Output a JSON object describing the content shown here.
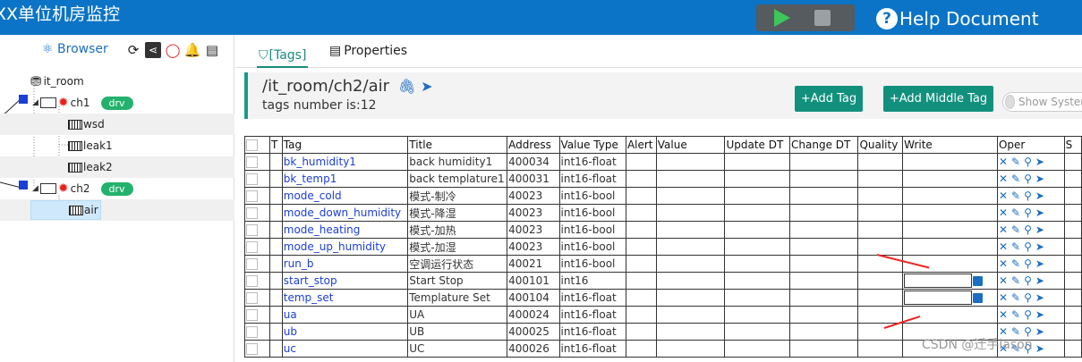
{
  "app": {
    "title": "XX单位机房监控",
    "help": "Help Document"
  },
  "left": {
    "browser_label": "Browser",
    "tree": [
      {
        "label": "it_room"
      },
      {
        "label": "ch1",
        "badge": "drv"
      },
      {
        "label": "wsd"
      },
      {
        "label": "leak1"
      },
      {
        "label": "leak2"
      },
      {
        "label": "ch2",
        "badge": "drv"
      },
      {
        "label": "air"
      }
    ]
  },
  "tabs": {
    "tags": "[Tags]",
    "properties": "Properties"
  },
  "path": {
    "title": "/it_room/ch2/air",
    "count": "tags number is:12"
  },
  "buttons": {
    "add_tag": "+Add Tag",
    "add_middle_tag": "+Add Middle Tag",
    "show_system": "Show System"
  },
  "table": {
    "headers": [
      "",
      "T",
      "Tag",
      "Title",
      "Address",
      "Value Type",
      "Alert",
      "Value",
      "Update DT",
      "Change DT",
      "Quality",
      "Write",
      "Oper",
      "S"
    ],
    "rows": [
      {
        "tag": "bk_humidity1",
        "title": "back humidity1",
        "address": "400034",
        "vtype": "int16-float"
      },
      {
        "tag": "bk_temp1",
        "title": "back templature1",
        "address": "400031",
        "vtype": "int16-float"
      },
      {
        "tag": "mode_cold",
        "title": "模式-制冷",
        "address": "40023",
        "vtype": "int16-bool"
      },
      {
        "tag": "mode_down_humidity",
        "title": "模式-降湿",
        "address": "40023",
        "vtype": "int16-bool"
      },
      {
        "tag": "mode_heating",
        "title": "模式-加热",
        "address": "40023",
        "vtype": "int16-bool"
      },
      {
        "tag": "mode_up_humidity",
        "title": "模式-加湿",
        "address": "40023",
        "vtype": "int16-bool"
      },
      {
        "tag": "run_b",
        "title": "空调运行状态",
        "address": "40021",
        "vtype": "int16-bool"
      },
      {
        "tag": "start_stop",
        "title": "Start Stop",
        "address": "400101",
        "vtype": "int16",
        "writable": true
      },
      {
        "tag": "temp_set",
        "title": "Templature Set",
        "address": "400104",
        "vtype": "int16-float",
        "writable": true
      },
      {
        "tag": "ua",
        "title": "UA",
        "address": "400024",
        "vtype": "int16-float"
      },
      {
        "tag": "ub",
        "title": "UB",
        "address": "400025",
        "vtype": "int16-float"
      },
      {
        "tag": "uc",
        "title": "UC",
        "address": "400026",
        "vtype": "int16-float"
      }
    ]
  },
  "watermark": "CSDN @迁手lason"
}
